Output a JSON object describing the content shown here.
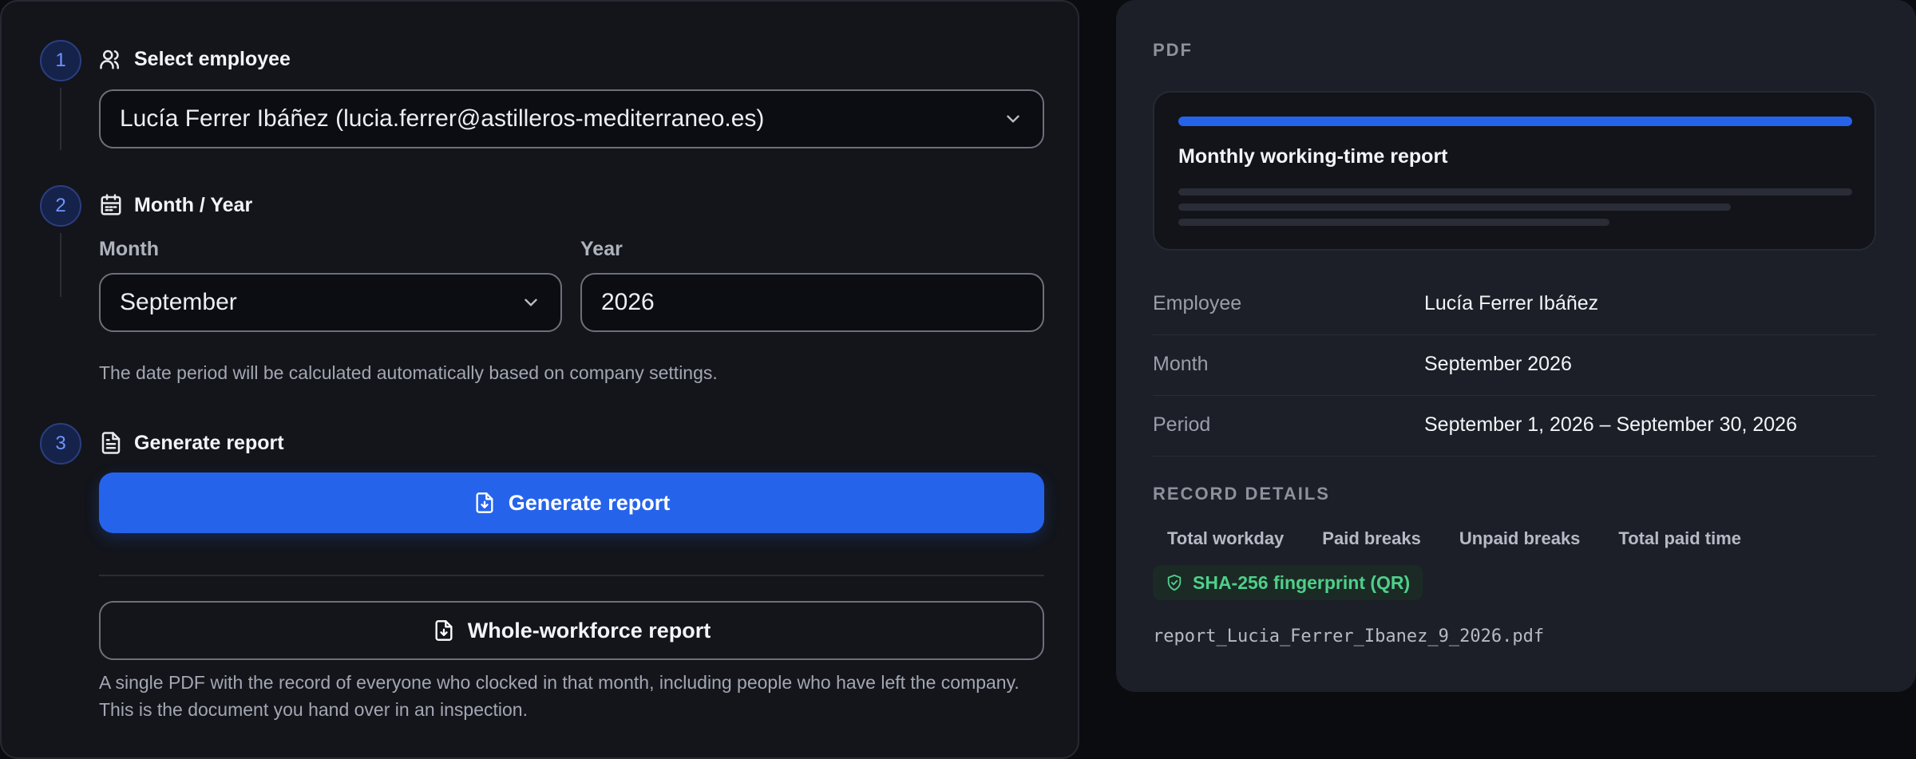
{
  "steps": [
    {
      "number": "1",
      "title": "Select employee",
      "icon": "users-icon"
    },
    {
      "number": "2",
      "title": "Month / Year",
      "icon": "calendar-icon"
    },
    {
      "number": "3",
      "title": "Generate report",
      "icon": "file-text-icon"
    }
  ],
  "employee": {
    "selected": "Lucía Ferrer Ibáñez (lucia.ferrer@astilleros-mediterraneo.es)"
  },
  "period": {
    "month_label": "Month",
    "month_value": "September",
    "year_label": "Year",
    "year_value": "2026",
    "help": "The date period will be calculated automatically based on company settings."
  },
  "actions": {
    "generate_label": "Generate report",
    "workforce_label": "Whole-workforce report",
    "workforce_help": "A single PDF with the record of everyone who clocked in that month, including people who have left the company. This is the document you hand over in an inspection."
  },
  "preview": {
    "section_label": "PDF",
    "card_title": "Monthly working-time report",
    "rows": [
      {
        "key": "Employee",
        "value": "Lucía Ferrer Ibáñez"
      },
      {
        "key": "Month",
        "value": "September 2026"
      },
      {
        "key": "Period",
        "value": "September 1, 2026 – September 30, 2026"
      }
    ],
    "record_details_label": "RECORD DETAILS",
    "record_details": [
      "Total workday",
      "Paid breaks",
      "Unpaid breaks",
      "Total paid time"
    ],
    "fingerprint_label": "SHA-256 fingerprint (QR)",
    "filename": "report_Lucia_Ferrer_Ibanez_9_2026.pdf"
  },
  "colors": {
    "accent": "#2563eb",
    "success": "#4fd08a",
    "panel": "#13151b",
    "preview_panel": "#1c1f28"
  }
}
